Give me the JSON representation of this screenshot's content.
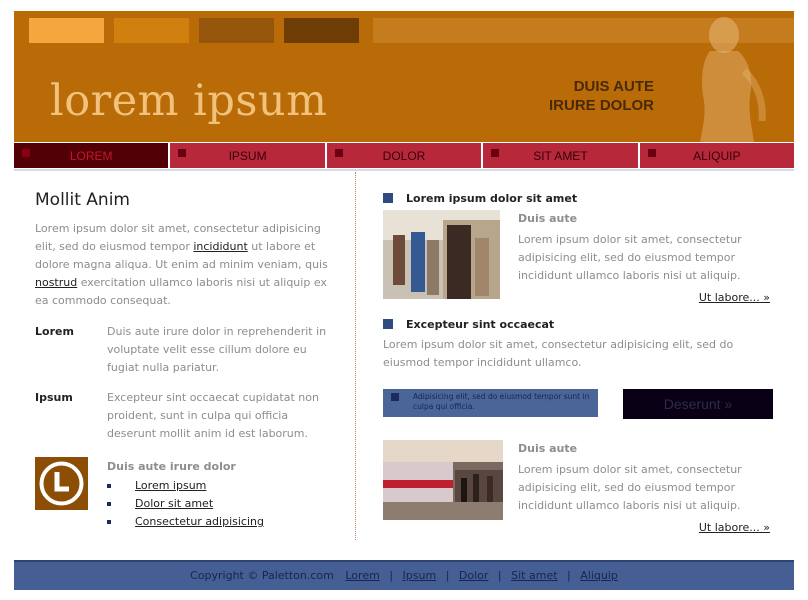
{
  "colors": {
    "header_bg": "#b96b08",
    "swatches": [
      "#f4a63f",
      "#d0800f",
      "#95560b",
      "#6e3d05"
    ],
    "nav_bg": "#b6283a",
    "nav_active_bg": "#520005",
    "footer_bg": "#455e93",
    "accent_blue": "#2e4a80"
  },
  "header": {
    "logo": "lorem ipsum",
    "tagline_line1": "DUIS AUTE",
    "tagline_line2": "IRURE DOLOR"
  },
  "nav": {
    "items": [
      {
        "label": "LOREM",
        "active": true
      },
      {
        "label": "IPSUM",
        "active": false
      },
      {
        "label": "DOLOR",
        "active": false
      },
      {
        "label": "SIT AMET",
        "active": false
      },
      {
        "label": "ALIQUIP",
        "active": false
      }
    ]
  },
  "left": {
    "title": "Mollit Anim",
    "intro_p1": "Lorem ipsum dolor sit amet, consectetur adipisicing elit, sed do eiusmod tempor ",
    "intro_link1": "incididunt",
    "intro_p2": " ut labore et dolore magna aliqua. Ut enim ad minim veniam, quis ",
    "intro_link2": "nostrud",
    "intro_p3": " exercitation ullamco laboris nisi ut aliquip ex ea commodo consequat.",
    "defs": [
      {
        "term": "Lorem",
        "desc": "Duis aute irure dolor in reprehenderit in voluptate velit esse cillum dolore eu fugiat nulla pariatur."
      },
      {
        "term": "Ipsum",
        "desc": "Excepteur sint occaecat cupidatat non proident, sunt in culpa qui officia deserunt mollit anim id est laborum."
      }
    ],
    "list_head": "Duis aute irure dolor",
    "list": [
      "Lorem ipsum",
      "Dolor sit amet",
      "Consectetur adipisicing"
    ]
  },
  "right": {
    "sec1_title": "Lorem ipsum dolor sit amet",
    "sec1_caption_head": "Duis aute",
    "sec1_caption_text": "Lorem ipsum dolor sit amet, consectetur adipisicing elit, sed do eiusmod tempor incididunt ullamco laboris nisi ut aliquip.",
    "sec1_more": "Ut labore... »",
    "sec2_title": "Excepteur sint occaecat",
    "sec2_text": "Lorem ipsum dolor sit amet, consectetur adipisicing elit, sed do eiusmod tempor incididunt ullamco.",
    "infobox_text": "Adipisicing elit, sed do eiusmod tempor sunt in culpa qui officia.",
    "button_label": "Deserunt »",
    "sec3_caption_head": "Duis aute",
    "sec3_caption_text": "Lorem ipsum dolor sit amet, consectetur adipisicing elit, sed do eiusmod tempor incididunt ullamco laboris nisi ut aliquip.",
    "sec3_more": "Ut labore... »"
  },
  "footer": {
    "copyright": "Copyright © Paletton.com",
    "links": [
      "Lorem",
      "Ipsum",
      "Dolor",
      "Sit amet",
      "Aliquip"
    ],
    "separator": "|"
  }
}
